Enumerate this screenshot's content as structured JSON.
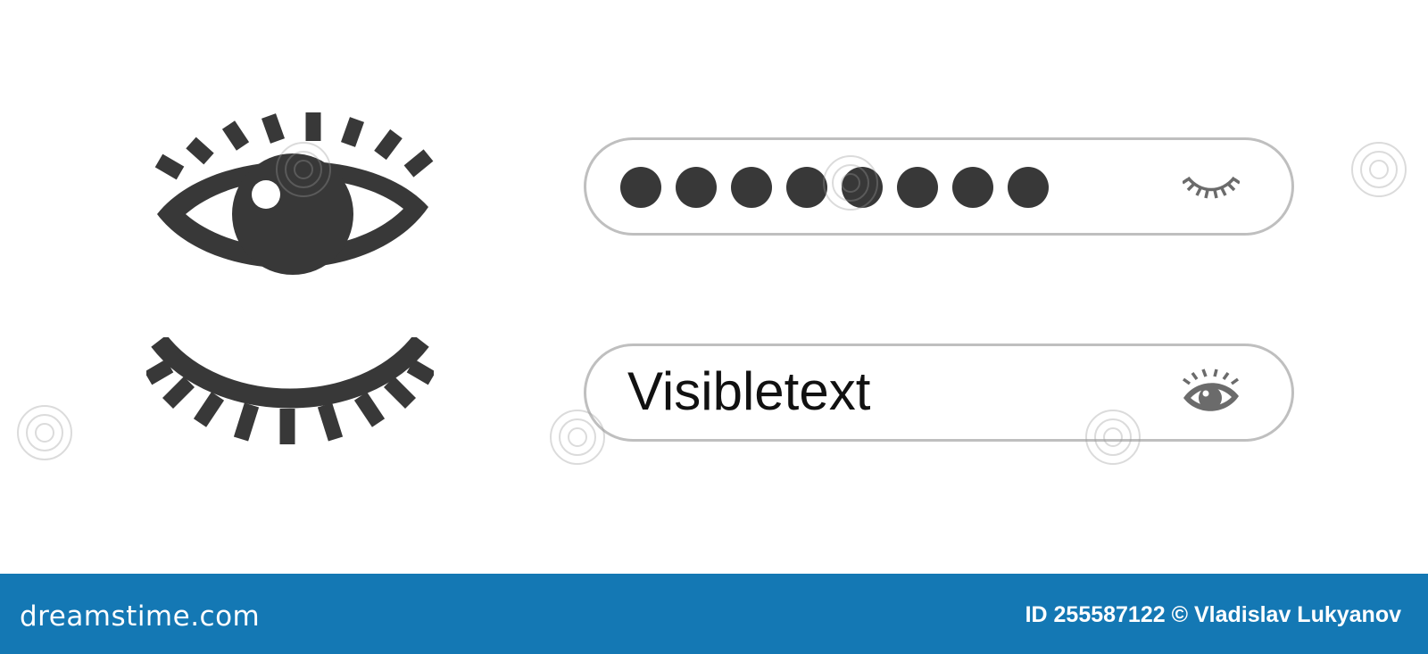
{
  "password_field": {
    "masked_char_count": 8,
    "toggle_icon": "closed-eye-icon"
  },
  "visible_field": {
    "value": "Visibletext",
    "toggle_icon": "open-eye-icon"
  },
  "illustration": {
    "open_eye_icon": "eye-open-icon",
    "closed_eye_icon": "eye-closed-icon"
  },
  "footer": {
    "logo": "dreamstime.com",
    "credit": "ID 255587122 © Vladislav Lukyanov"
  },
  "colors": {
    "icon": "#383838",
    "field_border": "#bfbfbf",
    "footer_bg": "#1478b4",
    "toggle_icon": "#6b6b6b"
  }
}
